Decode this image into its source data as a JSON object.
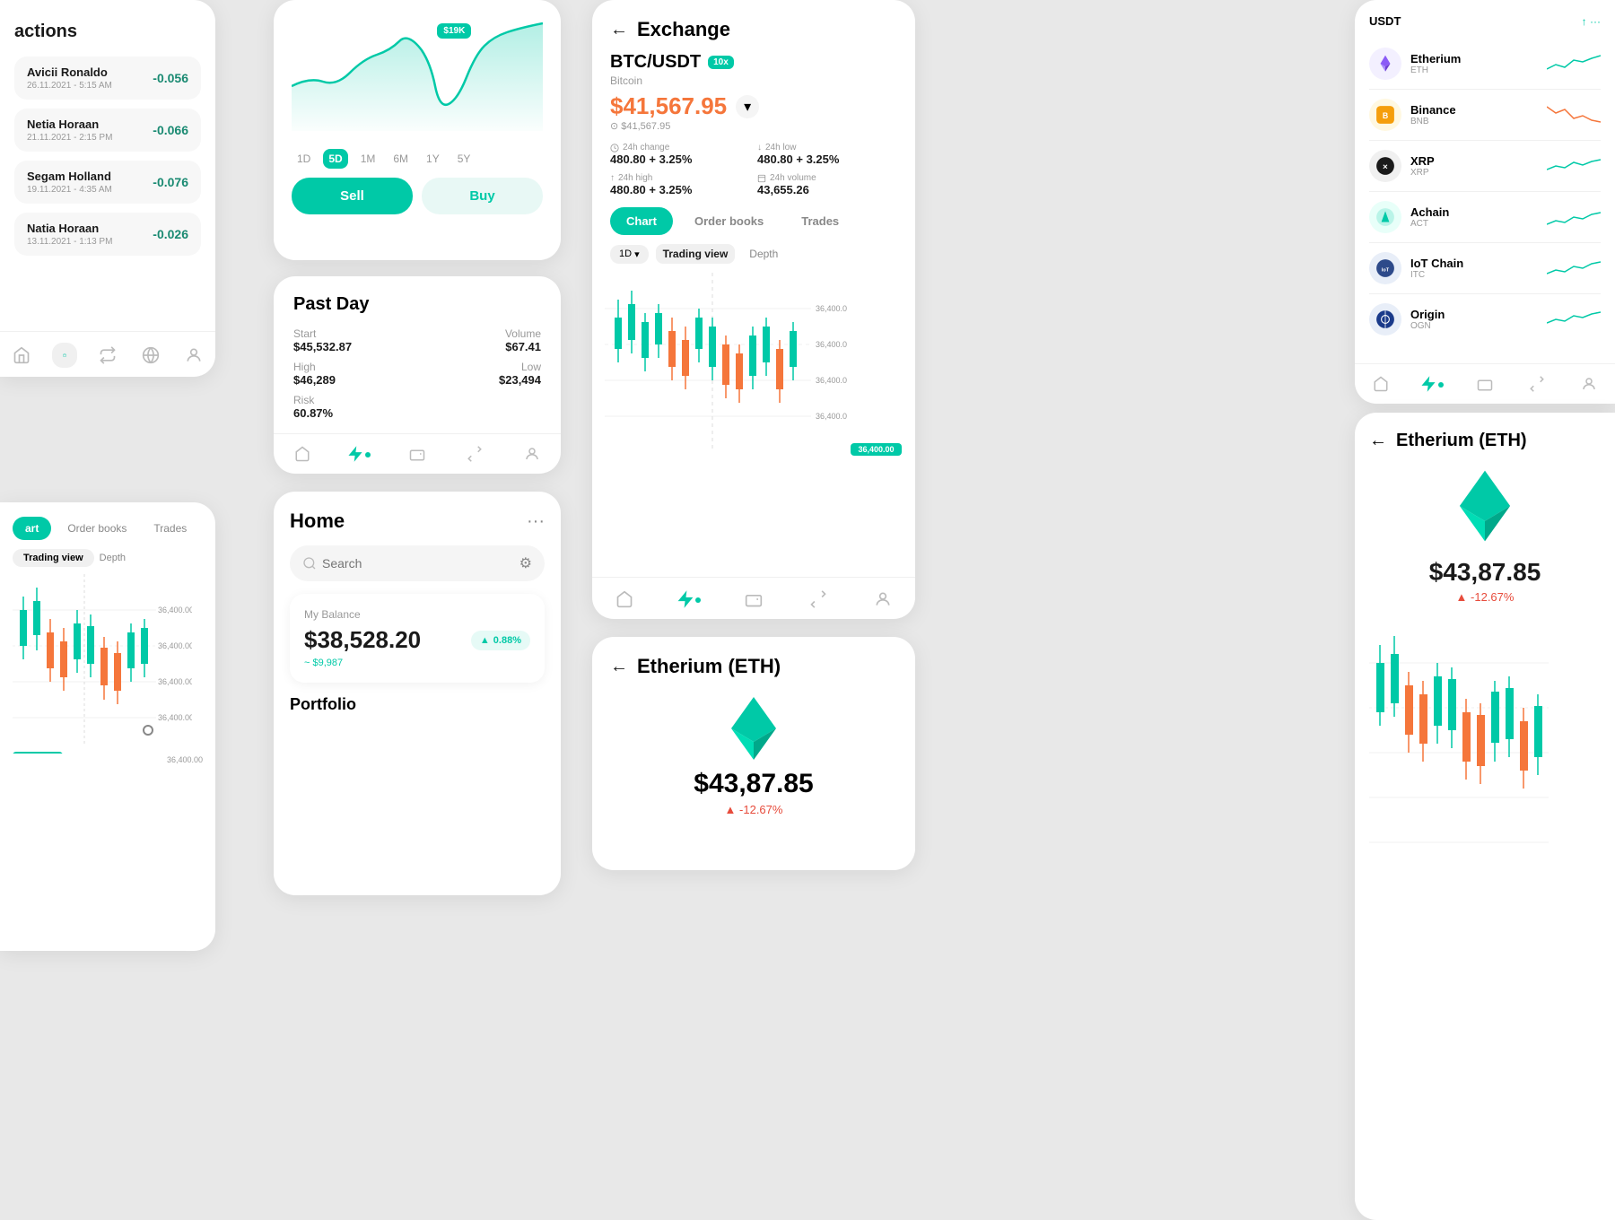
{
  "transactions": {
    "title": "actions",
    "items": [
      {
        "name": "Avicii Ronaldo",
        "date": "26.11.2021 - 5:15 AM",
        "value": "-0.056"
      },
      {
        "name": "Netia Horaan",
        "date": "21.11.2021 - 2:15 PM",
        "value": "-0.066"
      },
      {
        "name": "Segam Holland",
        "date": "19.11.2021 - 4:35 AM",
        "value": "-0.076"
      },
      {
        "name": "Natia Horaan",
        "date": "13.11.2021 - 1:13 PM",
        "value": "-0.026"
      }
    ]
  },
  "chart_top": {
    "price_tag": "$19K",
    "time_filters": [
      "1D",
      "5D",
      "1M",
      "6M",
      "1Y",
      "5Y"
    ],
    "active_filter": "5D",
    "sell_label": "Sell",
    "buy_label": "Buy"
  },
  "past_day": {
    "title": "Past Day",
    "start_label": "Start",
    "start_val": "$45,532.87",
    "volume_label": "Volume",
    "volume_val": "$67.41",
    "high_label": "High",
    "high_val": "$46,289",
    "low_label": "Low",
    "low_val": "$23,494",
    "risk_label": "Risk",
    "risk_val": "60.87%"
  },
  "home": {
    "title": "Home",
    "search_placeholder": "Search",
    "balance_label": "My Balance",
    "balance_amount": "$38,528.20",
    "balance_badge": "0.88%",
    "balance_sub": "~ $9,987",
    "portfolio_label": "Portfolio"
  },
  "exchange": {
    "title": "Exchange",
    "pair": "BTC/USDT",
    "leverage": "10x",
    "coin_name": "Bitcoin",
    "price": "$41,567.95",
    "price_ref": "⊙ $41,567.95",
    "change_24h_label": "24h change",
    "change_24h_val": "480.80 + 3.25%",
    "low_24h_label": "24h low",
    "low_24h_val": "480.80 + 3.25%",
    "high_24h_label": "24h high",
    "high_24h_val": "480.80 + 3.25%",
    "volume_24h_label": "24h volume",
    "volume_24h_val": "43,655.26",
    "tabs": [
      "Chart",
      "Order books",
      "Trades"
    ],
    "active_tab": "Chart",
    "view_tabs": [
      "Trading view",
      "Depth"
    ],
    "active_view": "Trading view",
    "period": "1D",
    "price_levels": [
      "36,400.00",
      "36,400.00",
      "36,400.00",
      "36,400.00",
      "36,400.00"
    ]
  },
  "eth_center": {
    "title": "Etherium (ETH)",
    "price": "$43,87.85",
    "change": "▲ -12.67%"
  },
  "crypto_list": {
    "usdt_name": "USDT",
    "usdt_change": "⬆",
    "items": [
      {
        "name": "Etherium",
        "sym": "ETH",
        "color": "#8b5cf6",
        "sparkline": "green"
      },
      {
        "name": "Binance",
        "sym": "BNB",
        "color": "#f59e0b",
        "sparkline": "red"
      },
      {
        "name": "XRP",
        "sym": "XRP",
        "color": "#1a1a1a",
        "sparkline": "green"
      },
      {
        "name": "Achain",
        "sym": "ACT",
        "color": "#00c9a7",
        "sparkline": "green"
      },
      {
        "name": "IoT Chain",
        "sym": "ITC",
        "color": "#2d4a8a",
        "sparkline": "green"
      },
      {
        "name": "Origin",
        "sym": "OGN",
        "color": "#2d4a8a",
        "sparkline": "green"
      }
    ]
  },
  "eth_right": {
    "title": "Etherium (ETH)",
    "price": "$43,87.85",
    "change": "▲ -12.67%"
  },
  "colors": {
    "teal": "#00c9a7",
    "orange": "#f5763b",
    "bg": "#e8e8e8"
  }
}
